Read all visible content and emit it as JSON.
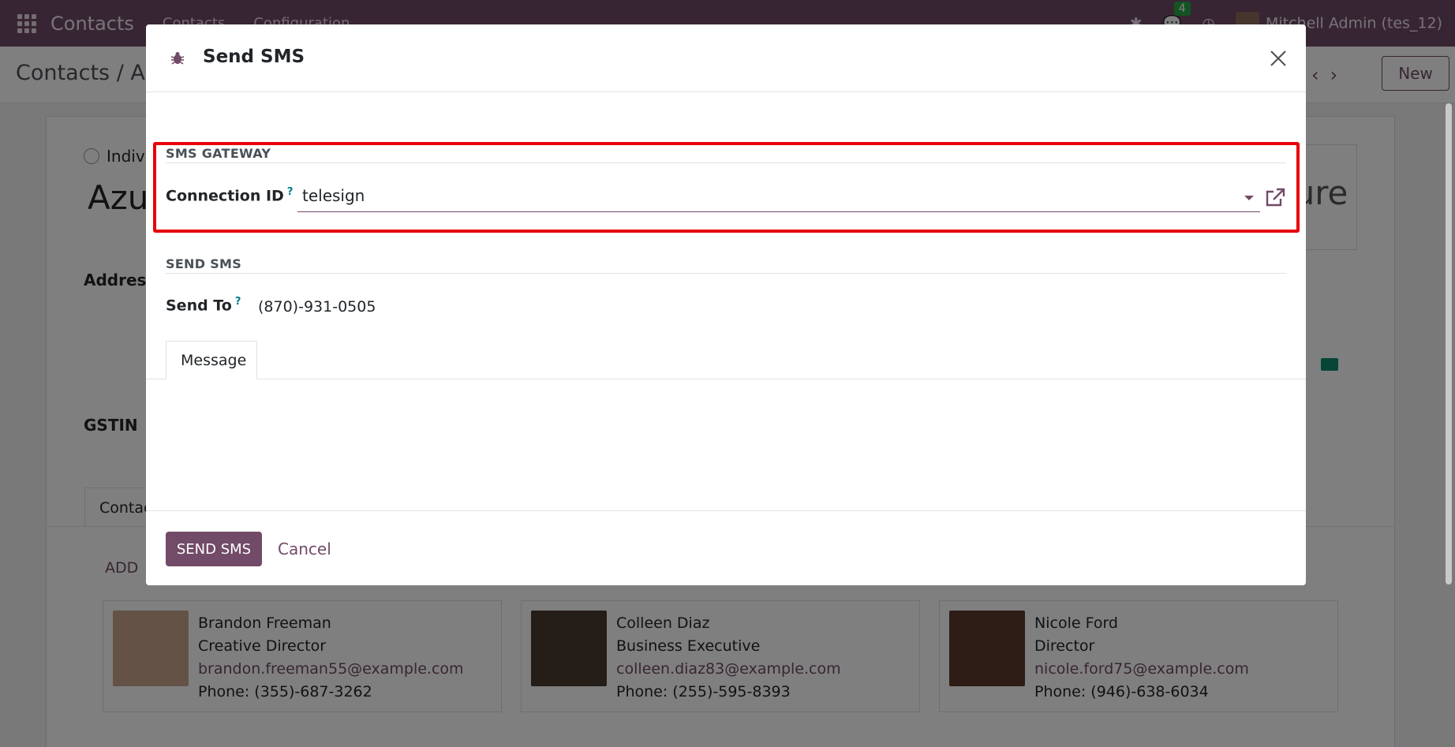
{
  "navbar": {
    "brand": "Contacts",
    "menu": [
      "Contacts",
      "Configuration"
    ],
    "badge_count": "4",
    "user": "Mitchell Admin (tes_12)"
  },
  "control_panel": {
    "breadcrumb": "Contacts / Azu",
    "new_label": "New"
  },
  "background_form": {
    "radio_label": "Indivi",
    "title": "Azu",
    "address_label": "Address",
    "gstin_label": "GSTIN",
    "logo_text": "ure",
    "tab_label": "Contac",
    "add_label": "ADD",
    "cards": [
      {
        "name": "Brandon Freeman",
        "role": "Creative Director",
        "email": "brandon.freeman55@example.com",
        "phone": "Phone: (355)-687-3262",
        "photo_color": "#c9a58f"
      },
      {
        "name": "Colleen Diaz",
        "role": "Business Executive",
        "email": "colleen.diaz83@example.com",
        "phone": "Phone: (255)-595-8393",
        "photo_color": "#4a3a30"
      },
      {
        "name": "Nicole Ford",
        "role": "Director",
        "email": "nicole.ford75@example.com",
        "phone": "Phone: (946)-638-6034",
        "photo_color": "#5b3b2c"
      }
    ]
  },
  "modal": {
    "title": "Send SMS",
    "gateway_section": "SMS GATEWAY",
    "connection_label": "Connection ID",
    "help_mark": "?",
    "connection_value": "telesign",
    "send_section": "SEND SMS",
    "send_to_label": "Send To",
    "send_to_value": "(870)-931-0505",
    "message_tab": "Message",
    "send_button": "SEND SMS",
    "cancel_button": "Cancel"
  },
  "colors": {
    "brand": "#714b67",
    "highlight": "#e8000b",
    "help": "#017e84"
  }
}
